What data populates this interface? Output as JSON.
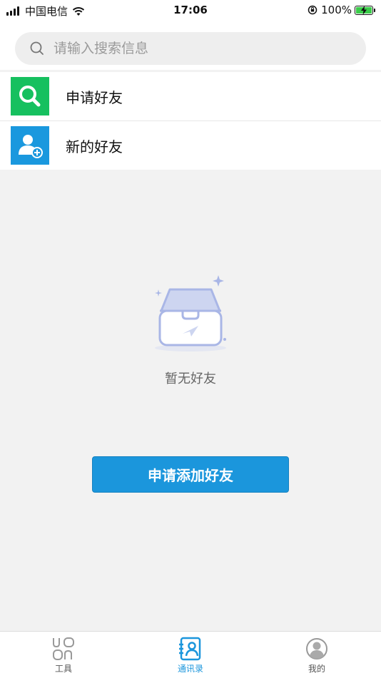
{
  "status_bar": {
    "carrier": "中国电信",
    "time": "17:06",
    "battery": "100%"
  },
  "search": {
    "placeholder": "请输入搜索信息"
  },
  "list": {
    "items": [
      {
        "label": "申请好友",
        "icon": "search-icon",
        "color": "#16c05f"
      },
      {
        "label": "新的好友",
        "icon": "add-user-icon",
        "color": "#1a98de"
      }
    ]
  },
  "empty": {
    "text": "暂无好友"
  },
  "action": {
    "add_label": "申请添加好友"
  },
  "tabs": [
    {
      "label": "工具",
      "icon": "tools-icon",
      "active": false
    },
    {
      "label": "通讯录",
      "icon": "contacts-icon",
      "active": true
    },
    {
      "label": "我的",
      "icon": "profile-icon",
      "active": false
    }
  ],
  "colors": {
    "accent": "#1b96dc",
    "green": "#16c05f",
    "background": "#f2f2f2"
  }
}
